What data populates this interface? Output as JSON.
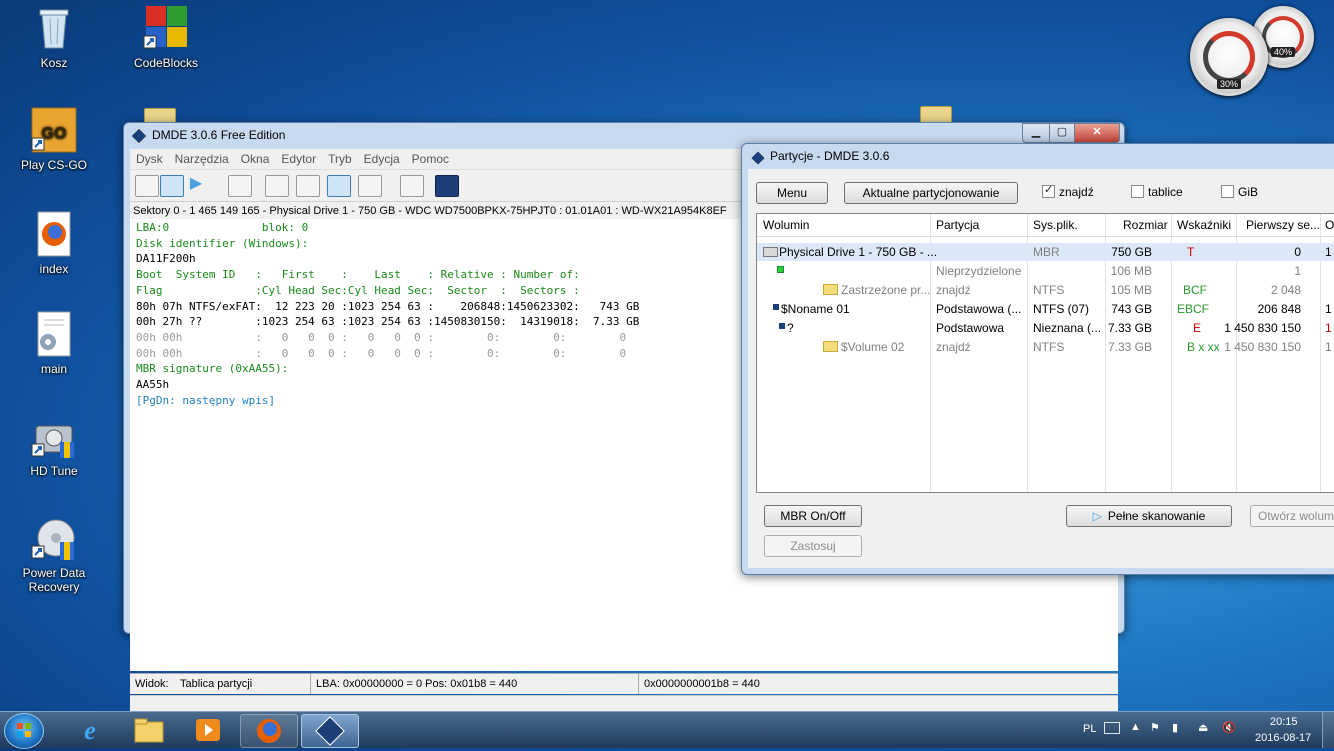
{
  "desktop": {
    "icons": [
      {
        "label": "Kosz",
        "icon": "recycle-bin-icon"
      },
      {
        "label": "CodeBlocks",
        "icon": "codeblocks-icon"
      },
      {
        "label": "Play CS-GO",
        "icon": "csgo-icon"
      },
      {
        "label": "index",
        "icon": "firefox-icon"
      },
      {
        "label": "main",
        "icon": "settings-file-icon"
      },
      {
        "label": "HD Tune",
        "icon": "hdtune-icon"
      },
      {
        "label": "Power Data Recovery",
        "icon": "power-data-recovery-icon"
      }
    ],
    "gadget": {
      "cpu_pct": "30%",
      "mem_pct": "40%"
    }
  },
  "main_window": {
    "title": "DMDE 3.0.6 Free Edition",
    "menu": [
      "Dysk",
      "Narzędzia",
      "Okna",
      "Edytor",
      "Tryb",
      "Edycja",
      "Pomoc"
    ],
    "path": "Sektory 0 - 1 465 149 165 - Physical Drive 1 - 750 GB - WDC WD7500BPKX-75HPJT0 : 01.01A01 : WD-WX21A954K8EF",
    "hex_lines": [
      "LBA:0              blok: 0",
      "Disk identifier (Windows):",
      "DA11F200h",
      "Boot  System ID   :   First    :    Last    : Relative : Number of:",
      "Flag              :Cyl Head Sec:Cyl Head Sec:  Sector  :  Sectors :",
      "80h 07h NTFS/exFAT:  12 223 20 :1023 254 63 :    206848:1450623302:   743 GB",
      "00h 27h ??        :1023 254 63 :1023 254 63 :1450830150:  14319018:  7.33 GB",
      "00h 00h           :   0   0  0 :   0   0  0 :        0:        0:        0",
      "00h 00h           :   0   0  0 :   0   0  0 :        0:        0:        0",
      "MBR signature (0xAA55):",
      "AA55h",
      "[PgDn: następny wpis]"
    ],
    "status": {
      "view_label": "Widok:",
      "view_value": "Tablica partycji",
      "lba": "LBA: 0x00000000 = 0  Pos: 0x01b8 = 440",
      "offset": "0x0000000001b8 = 440"
    }
  },
  "partitions_window": {
    "title": "Partycje - DMDE 3.0.6",
    "menu_button": "Menu",
    "current_partitioning_button": "Aktualne partycjonowanie",
    "checkboxes": [
      {
        "label": "znajdź",
        "checked": true
      },
      {
        "label": "tablice",
        "checked": false
      },
      {
        "label": "GiB",
        "checked": false
      }
    ],
    "columns": [
      "Wolumin",
      "Partycja",
      "Sys.plik.",
      "Rozmiar",
      "Wskaźniki",
      "Pierwszy se...",
      "O"
    ],
    "rows": [
      {
        "volume": "Physical Drive 1 - 750 GB - ...",
        "partition": "",
        "fs": "MBR",
        "size": "750 GB",
        "flags": "T",
        "first": "0",
        "o": "1"
      },
      {
        "volume": "",
        "partition": "Nieprzydzielone",
        "fs": "",
        "size": "106 MB",
        "flags": "",
        "first": "1",
        "o": ""
      },
      {
        "volume": "Zastrzeżone pr...",
        "partition": "znajdź",
        "fs": "NTFS",
        "size": "105 MB",
        "flags": "BCF",
        "first": "2 048",
        "o": ""
      },
      {
        "volume": "$Noname 01",
        "partition": "Podstawowa (...",
        "fs": "NTFS (07)",
        "size": "743 GB",
        "flags": "EBCF",
        "first": "206 848",
        "o": "1"
      },
      {
        "volume": "?",
        "partition": "Podstawowa",
        "fs": "Nieznana (...",
        "size": "7.33 GB",
        "flags": "E",
        "first": "1 450 830 150",
        "o": "1"
      },
      {
        "volume": "$Volume 02",
        "partition": "znajdź",
        "fs": "NTFS",
        "size": "7.33 GB",
        "flags": "B x xx",
        "first": "1 450 830 150",
        "o": "1"
      }
    ],
    "mbr_button": "MBR On/Off",
    "apply_button": "Zastosuj",
    "full_scan_button": "Pełne skanowanie",
    "open_volume_button": "Otwórz wolum"
  },
  "taskbar": {
    "language": "PL",
    "time": "20:15",
    "date": "2016-08-17"
  },
  "colors": {
    "hex_text": "#1a8a1a",
    "flag_red": "#d00000",
    "flag_green": "#2b9a2b"
  }
}
